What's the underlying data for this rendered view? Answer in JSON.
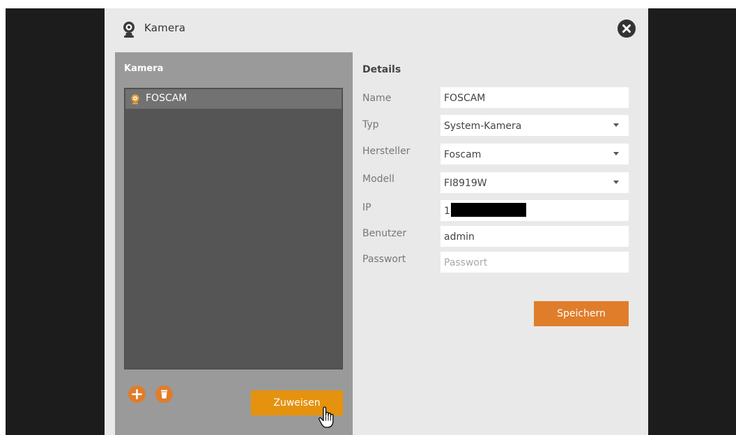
{
  "window": {
    "title": "Kamera"
  },
  "left_panel": {
    "heading": "Kamera",
    "cameras": [
      {
        "name": "FOSCAM"
      }
    ],
    "assign_label": "Zuweisen"
  },
  "details": {
    "heading": "Details",
    "name": {
      "label": "Name",
      "value": "FOSCAM"
    },
    "typ": {
      "label": "Typ",
      "value": "System-Kamera"
    },
    "hersteller": {
      "label": "Hersteller",
      "value": "Foscam"
    },
    "modell": {
      "label": "Modell",
      "value": "FI8919W"
    },
    "ip": {
      "label": "IP",
      "value": "1"
    },
    "benutzer": {
      "label": "Benutzer",
      "value": "admin"
    },
    "passwort": {
      "label": "Passwort",
      "placeholder": "Passwort"
    },
    "save_label": "Speichern"
  },
  "colors": {
    "accent_orange": "#e07d2b",
    "assign_orange": "#e5920f",
    "panel_gray": "#9a9a9a",
    "list_dark": "#555555",
    "backdrop": "#1c1c1c"
  },
  "icons": {
    "title": "webcam-icon",
    "close": "close-icon",
    "list_item": "webcam-icon",
    "add": "plus-icon",
    "delete": "trash-icon",
    "cursor": "hand-pointer-icon"
  }
}
